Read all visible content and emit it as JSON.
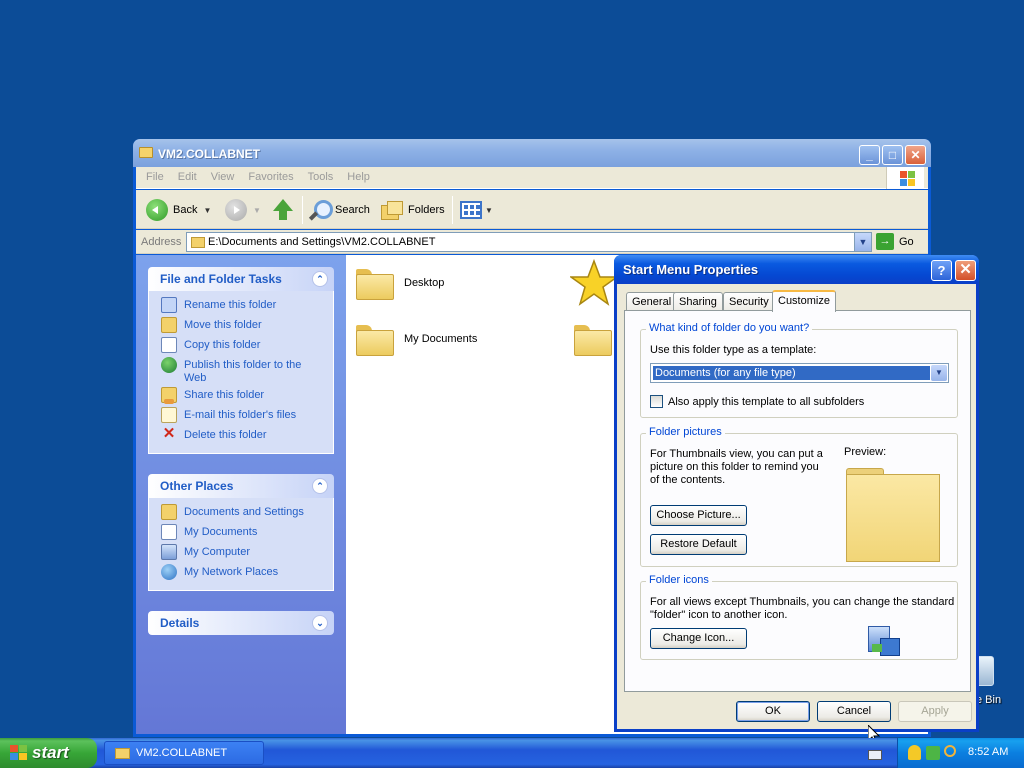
{
  "desktop": {
    "recycle_bin_label": "e Bin"
  },
  "explorer": {
    "title": "VM2.COLLABNET",
    "menu": [
      "File",
      "Edit",
      "View",
      "Favorites",
      "Tools",
      "Help"
    ],
    "toolbar": {
      "back": "Back",
      "search": "Search",
      "folders": "Folders"
    },
    "address": {
      "label": "Address",
      "value": "E:\\Documents and Settings\\VM2.COLLABNET",
      "go": "Go"
    },
    "file_folder_tasks": {
      "title": "File and Folder Tasks",
      "items": [
        "Rename this folder",
        "Move this folder",
        "Copy this folder",
        "Publish this folder to the Web",
        "Share this folder",
        "E-mail this folder's files",
        "Delete this folder"
      ]
    },
    "other_places": {
      "title": "Other Places",
      "items": [
        "Documents and Settings",
        "My Documents",
        "My Computer",
        "My Network Places"
      ]
    },
    "details": {
      "title": "Details"
    },
    "content_items": [
      "Desktop",
      "My Documents"
    ]
  },
  "dialog": {
    "title": "Start Menu Properties",
    "help_glyph": "?",
    "tabs": [
      "General",
      "Sharing",
      "Security",
      "Customize"
    ],
    "active_tab": "Customize",
    "folder_type": {
      "title": "What kind of folder do you want?",
      "template_label": "Use this folder type as a template:",
      "template_value": "Documents (for any file type)",
      "apply_subfolders": "Also apply this template to all subfolders",
      "apply_subfolders_checked": false
    },
    "folder_pictures": {
      "title": "Folder pictures",
      "description": "For Thumbnails view, you can put a picture on this folder to remind you of the contents.",
      "preview_label": "Preview:",
      "choose_picture": "Choose Picture...",
      "restore_default": "Restore Default"
    },
    "folder_icons": {
      "title": "Folder icons",
      "description": "For all views except Thumbnails, you can change the standard \"folder\" icon to another icon.",
      "change_icon": "Change Icon..."
    },
    "buttons": {
      "ok": "OK",
      "cancel": "Cancel",
      "apply": "Apply"
    }
  },
  "taskbar": {
    "start_label": "start",
    "task_button": "VM2.COLLABNET",
    "clock": "8:52 AM"
  },
  "colors": {
    "desktop_bg": "#0c4c97",
    "link_blue": "#215dc6",
    "group_title_blue": "#0046d5",
    "selection_blue": "#316ac5"
  }
}
